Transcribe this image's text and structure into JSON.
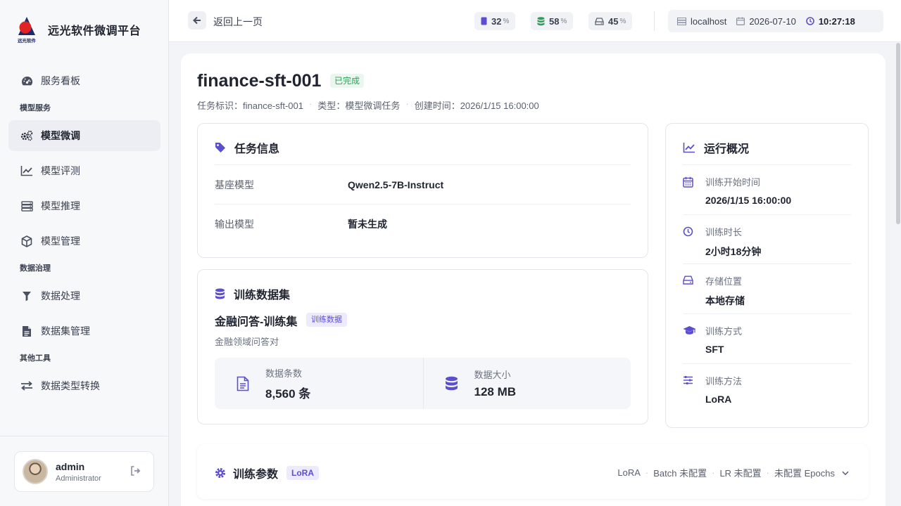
{
  "brand": {
    "name": "远光软件微调平台",
    "logo_text": "远光软件"
  },
  "sidebar": {
    "top_item": {
      "label": "服务看板",
      "icon": "dashboard-icon"
    },
    "groups": [
      {
        "title": "模型服务",
        "items": [
          {
            "label": "模型微调",
            "icon": "cogs-icon",
            "active": true
          },
          {
            "label": "模型评测",
            "icon": "chart-line-icon"
          },
          {
            "label": "模型推理",
            "icon": "server-icon"
          },
          {
            "label": "模型管理",
            "icon": "cube-icon"
          }
        ]
      },
      {
        "title": "数据治理",
        "items": [
          {
            "label": "数据处理",
            "icon": "filter-icon"
          },
          {
            "label": "数据集管理",
            "icon": "file-icon"
          }
        ]
      },
      {
        "title": "其他工具",
        "items": [
          {
            "label": "数据类型转换",
            "icon": "exchange-icon"
          }
        ]
      }
    ]
  },
  "user": {
    "name": "admin",
    "role": "Administrator"
  },
  "topbar": {
    "back_label": "返回上一页",
    "metrics": [
      {
        "name": "cpu",
        "value": "32",
        "unit": "%",
        "icon": "memory-icon"
      },
      {
        "name": "memory",
        "value": "58",
        "unit": "%",
        "icon": "database-icon"
      },
      {
        "name": "disk",
        "value": "45",
        "unit": "%",
        "icon": "hdd-icon"
      }
    ],
    "host": "localhost",
    "date": "2026-07-10",
    "time": "10:27:18"
  },
  "task": {
    "title": "finance-sft-001",
    "status": "已完成",
    "meta": {
      "id_label": "任务标识：finance-sft-001",
      "type_label": "类型：模型微调任务",
      "created_label": "创建时间：2026/1/15 16:00:00"
    }
  },
  "task_info": {
    "heading": "任务信息",
    "rows": [
      {
        "key": "基座模型",
        "value": "Qwen2.5-7B-Instruct"
      },
      {
        "key": "输出模型",
        "value": "暂未生成"
      }
    ]
  },
  "dataset": {
    "heading": "训练数据集",
    "name": "金融问答-训练集",
    "tag": "训练数据",
    "desc": "金融领域问答对",
    "stats": [
      {
        "label": "数据条数",
        "value": "8,560 条"
      },
      {
        "label": "数据大小",
        "value": "128 MB"
      }
    ]
  },
  "run": {
    "heading": "运行概况",
    "items": [
      {
        "label": "训练开始时间",
        "value": "2026/1/15 16:00:00",
        "icon": "calendar-icon"
      },
      {
        "label": "训练时长",
        "value": "2小时18分钟",
        "icon": "clock-icon"
      },
      {
        "label": "存储位置",
        "value": "本地存储",
        "icon": "hdd-icon"
      },
      {
        "label": "训练方式",
        "value": "SFT",
        "icon": "graduation-cap-icon"
      },
      {
        "label": "训练方法",
        "value": "LoRA",
        "icon": "sliders-icon"
      }
    ]
  },
  "params": {
    "heading": "训练参数",
    "badge": "LoRA",
    "summary": [
      "LoRA",
      "Batch 未配置",
      "LR 未配置",
      "未配置 Epochs"
    ]
  },
  "colors": {
    "accent": "#5b4fcf",
    "success": "#2f9e5b",
    "logo_red": "#e02424",
    "logo_navy": "#1e2a6e"
  }
}
